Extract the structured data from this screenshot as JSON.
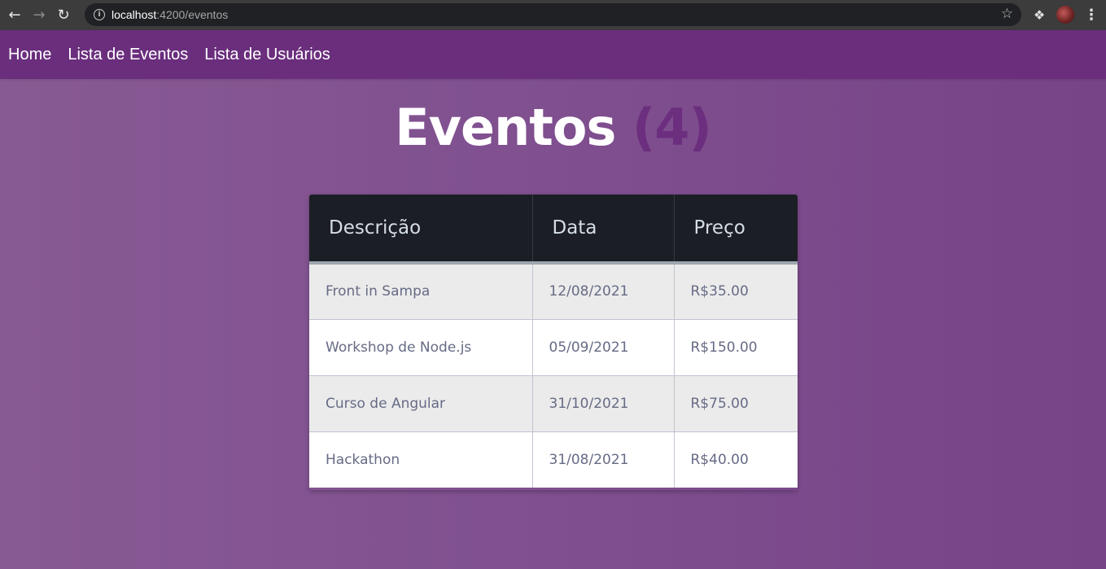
{
  "browser": {
    "url_host": "localhost",
    "url_path": ":4200/eventos",
    "icons": [
      "back-icon",
      "forward-icon",
      "reload-icon",
      "info-icon",
      "star-icon",
      "extensions-icon",
      "avatar",
      "menu-icon"
    ]
  },
  "nav": {
    "items": [
      {
        "label": "Home"
      },
      {
        "label": "Lista de Eventos"
      },
      {
        "label": "Lista de Usuários"
      }
    ]
  },
  "page": {
    "title": "Eventos",
    "count": "(4)"
  },
  "table": {
    "headers": [
      "Descrição",
      "Data",
      "Preço"
    ],
    "rows": [
      [
        "Front in Sampa",
        "12/08/2021",
        "R$35.00"
      ],
      [
        "Workshop de Node.js",
        "05/09/2021",
        "R$150.00"
      ],
      [
        "Curso de Angular",
        "31/10/2021",
        "R$75.00"
      ],
      [
        "Hackathon",
        "31/08/2021",
        "R$40.00"
      ]
    ]
  },
  "colors": {
    "navbar": "#6a2e7d",
    "background": "#7f4f8f",
    "count_accent": "#6c2e7e",
    "table_header": "#1b1e24"
  }
}
